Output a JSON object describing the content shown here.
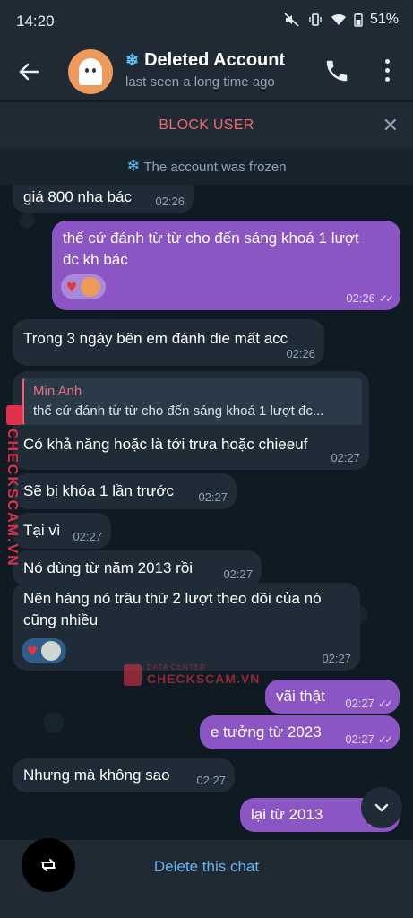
{
  "status": {
    "time": "14:20",
    "battery": "51%"
  },
  "header": {
    "title": "Deleted Account",
    "subtitle": "last seen a long time ago",
    "title_icon": "snowflake-icon"
  },
  "banner": {
    "block_label": "BLOCK USER",
    "frozen_text": "The account was frozen"
  },
  "messages": [
    {
      "text": "giá 800 nha bác",
      "time": "02:26"
    },
    {
      "text_line1": "thế cứ đánh từ từ cho đến sáng khoá 1 lượt",
      "text_line2": "đc kh bác",
      "time": "02:26"
    },
    {
      "text": "Trong 3 ngày bên em đánh die mất acc",
      "time": "02:26"
    },
    {
      "quote_name": "Min Anh",
      "quote_text": "thế cứ đánh từ từ cho đến sáng khoá 1 lượt đc...",
      "text": "Có khả năng hoặc là tới trưa hoặc chieeuf",
      "time": "02:27"
    },
    {
      "text": "Sẽ bị khóa 1 lần trước",
      "time": "02:27"
    },
    {
      "text": "Tại vì",
      "time": "02:27"
    },
    {
      "text": "Nó dùng từ năm 2013 rồi",
      "time": "02:27"
    },
    {
      "text_line1": "Nên hàng nó trâu thứ 2 lượt theo dõi của nó",
      "text_line2": "cũng nhiều",
      "time": "02:27"
    },
    {
      "text": "vãi thật",
      "time": "02:27"
    },
    {
      "text": "e tưởng từ 2023",
      "time": "02:27"
    },
    {
      "text": "Nhưng mà không sao",
      "time": "02:27"
    },
    {
      "text": "lại từ 2013",
      "time": "02:2"
    }
  ],
  "watermark": {
    "vertical": "CHECKSCAM.VN",
    "small": "DATA CENTER",
    "main": "CHECKSCAM.VN"
  },
  "bottom": {
    "delete_label": "Delete this chat"
  },
  "colors": {
    "accent": "#62b4f2",
    "outgoing": "#8b55c4",
    "incoming": "#1f2b36",
    "danger": "#ef6b6b"
  }
}
